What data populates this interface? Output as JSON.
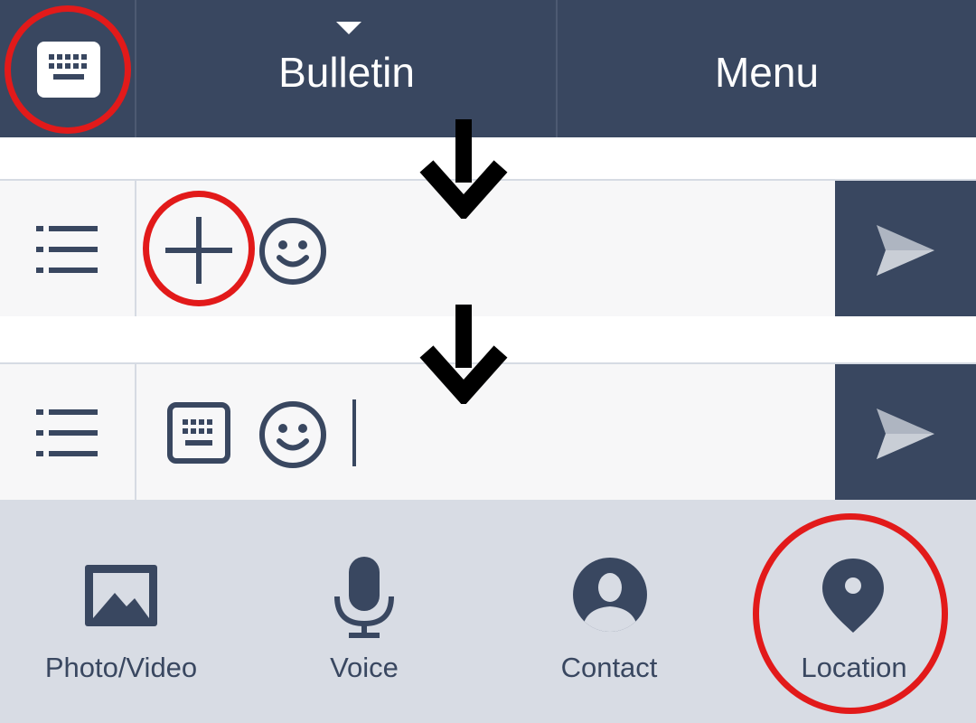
{
  "topbar": {
    "bulletin_label": "Bulletin",
    "menu_label": "Menu"
  },
  "panel": {
    "items": [
      {
        "label": "Photo/Video",
        "icon": "photo-icon"
      },
      {
        "label": "Voice",
        "icon": "microphone-icon"
      },
      {
        "label": "Contact",
        "icon": "contact-icon"
      },
      {
        "label": "Location",
        "icon": "location-pin-icon"
      }
    ]
  },
  "colors": {
    "nav_bg": "#394760",
    "icon": "#394760",
    "input_bg": "#f7f7f8",
    "panel_bg": "#d8dce4",
    "highlight": "#e21a1a"
  }
}
